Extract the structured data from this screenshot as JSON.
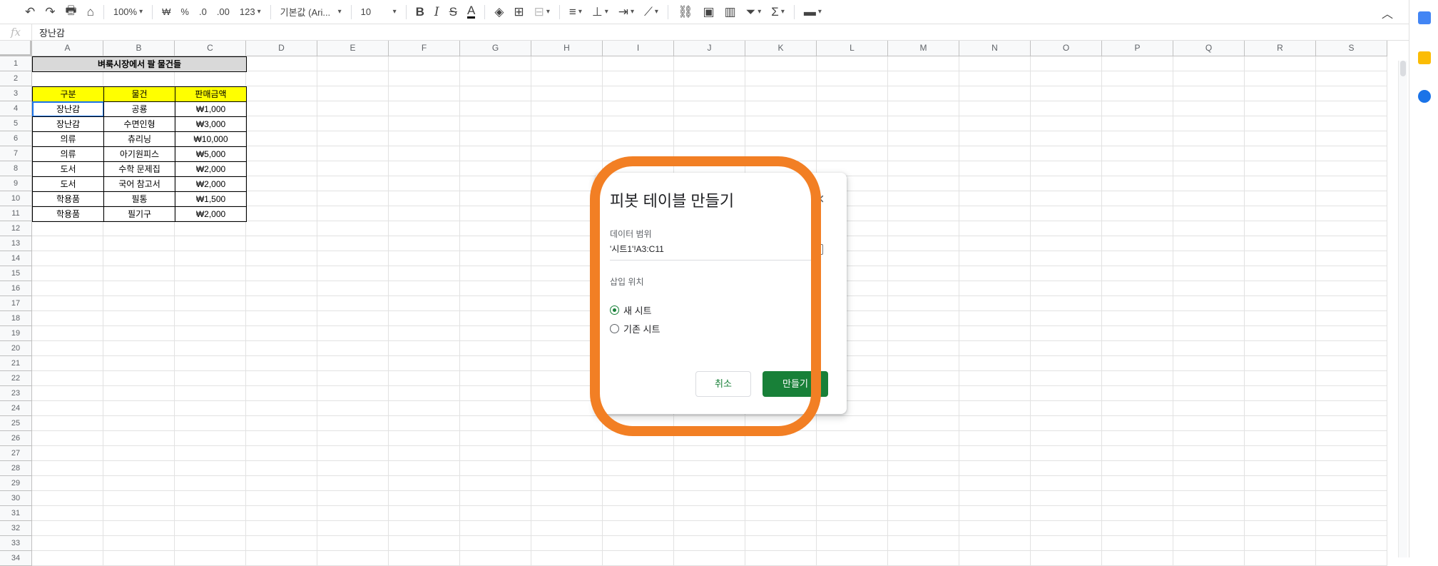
{
  "toolbar": {
    "zoom": "100%",
    "currency": "₩",
    "percent": "%",
    "dec_decrease": ".0",
    "dec_increase": ".00",
    "format_more": "123",
    "font": "기본값 (Ari...",
    "font_size": "10"
  },
  "formula_bar": {
    "fx": "fx",
    "value": "장난감"
  },
  "columns": [
    "A",
    "B",
    "C",
    "D",
    "E",
    "F",
    "G",
    "H",
    "I",
    "J",
    "K",
    "L",
    "M",
    "N",
    "O",
    "P",
    "Q",
    "R",
    "S"
  ],
  "rows": [
    "1",
    "2",
    "3",
    "4",
    "5",
    "6",
    "7",
    "8",
    "9",
    "10",
    "11",
    "12",
    "13",
    "14",
    "15",
    "16",
    "17",
    "18",
    "19",
    "20",
    "21",
    "22",
    "23",
    "24",
    "25",
    "26",
    "27",
    "28",
    "29",
    "30",
    "31",
    "32",
    "33",
    "34"
  ],
  "sheet": {
    "title": "벼룩시장에서 팔 물건들",
    "headers": [
      "구분",
      "물건",
      "판매금액"
    ],
    "data": [
      [
        "장난감",
        "공룡",
        "₩1,000"
      ],
      [
        "장난감",
        "수면인형",
        "₩3,000"
      ],
      [
        "의류",
        "츄리닝",
        "₩10,000"
      ],
      [
        "의류",
        "아기원피스",
        "₩5,000"
      ],
      [
        "도서",
        "수학 문제집",
        "₩2,000"
      ],
      [
        "도서",
        "국어 참고서",
        "₩2,000"
      ],
      [
        "학용품",
        "필통",
        "₩1,500"
      ],
      [
        "학용품",
        "필기구",
        "₩2,000"
      ]
    ]
  },
  "dialog": {
    "title": "피봇 테이블 만들기",
    "close": "×",
    "range_label": "데이터 범위",
    "range_value": "'시트1'!A3:C11",
    "insert_label": "삽입 위치",
    "option_new": "새 시트",
    "option_existing": "기존 시트",
    "cancel": "취소",
    "create": "만들기"
  },
  "colors": {
    "accent_green": "#188038",
    "highlight_orange": "#f27f24",
    "header_yellow": "#ffff00",
    "title_gray": "#d9d9d9",
    "selection_blue": "#1a73e8"
  }
}
